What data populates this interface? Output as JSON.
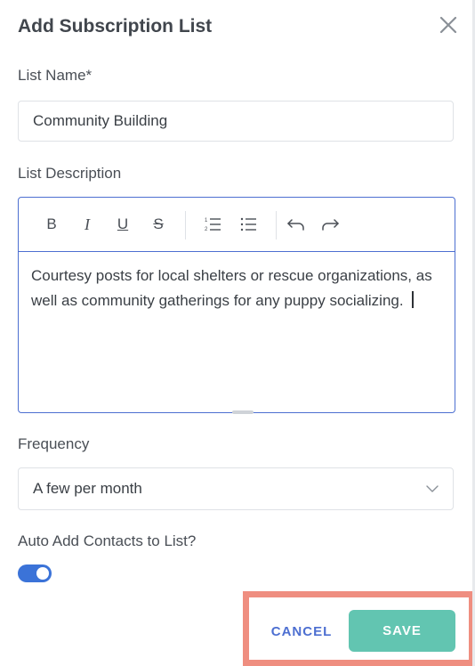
{
  "modal": {
    "title": "Add Subscription List",
    "close_icon": "close-icon"
  },
  "list_name": {
    "label": "List Name*",
    "value": "Community Building"
  },
  "list_description": {
    "label": "List Description",
    "toolbar": [
      {
        "name": "bold-button",
        "glyph": "B",
        "icon": "bold-icon"
      },
      {
        "name": "italic-button",
        "glyph": "I",
        "icon": "italic-icon"
      },
      {
        "name": "underline-button",
        "glyph": "U",
        "icon": "underline-icon"
      },
      {
        "name": "strikethrough-button",
        "glyph": "S",
        "icon": "strikethrough-icon"
      },
      {
        "name": "ordered-list-button",
        "icon": "ordered-list-icon"
      },
      {
        "name": "bullet-list-button",
        "icon": "bullet-list-icon"
      },
      {
        "name": "undo-button",
        "icon": "undo-icon"
      },
      {
        "name": "redo-button",
        "icon": "redo-icon"
      }
    ],
    "text": "Courtesy posts for local shelters or rescue organizations, as well as community gatherings for any puppy socializing."
  },
  "frequency": {
    "label": "Frequency",
    "selected": "A few per month"
  },
  "auto_add": {
    "label": "Auto Add Contacts to List?",
    "enabled": true
  },
  "footer": {
    "cancel_label": "CANCEL",
    "save_label": "SAVE"
  },
  "colors": {
    "accent_blue": "#4d6fd1",
    "toggle_on": "#3b73d8",
    "save_green": "#62c5b1",
    "highlight_border": "#ef8e80"
  }
}
